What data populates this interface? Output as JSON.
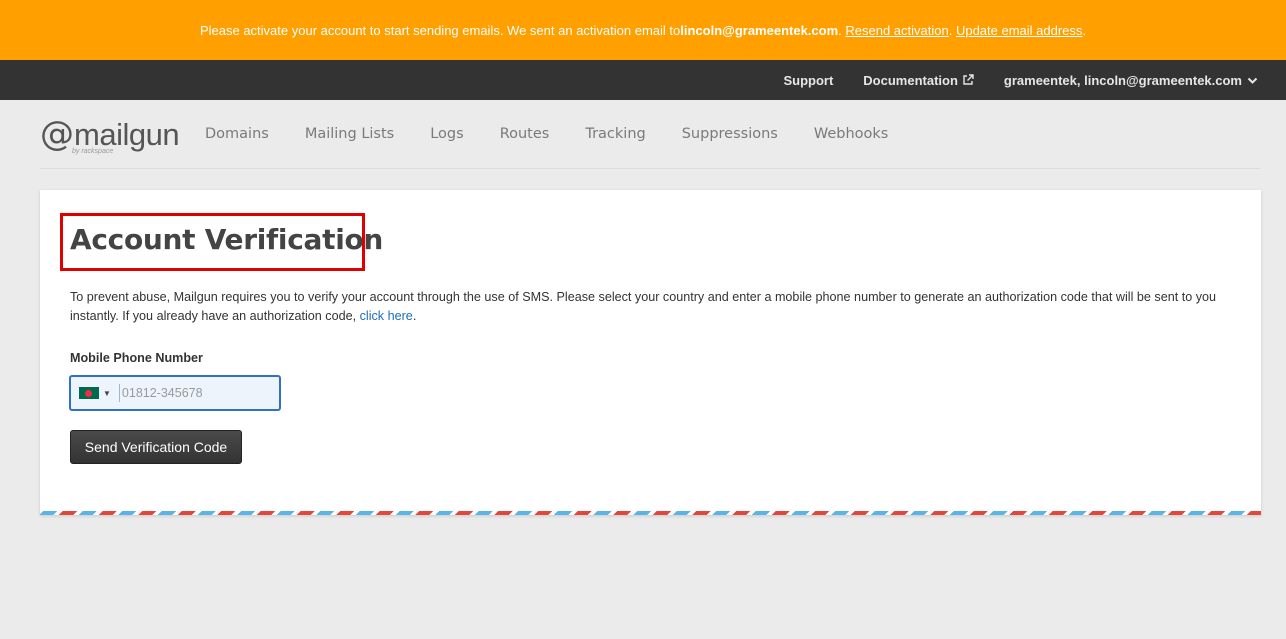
{
  "banner": {
    "text_before": "Please activate your account to start sending emails. We sent an activation email to ",
    "email": "lincoln@grameentek.com",
    "sep1": ". ",
    "resend_link": "Resend activation",
    "sep2": ". ",
    "update_link": "Update email address",
    "end": "."
  },
  "topbar": {
    "support": "Support",
    "documentation": "Documentation",
    "account": "grameentek, lincoln@grameentek.com"
  },
  "logo": {
    "at": "@",
    "word": "mailgun",
    "by": "by rackspace"
  },
  "nav": {
    "links": [
      "Domains",
      "Mailing Lists",
      "Logs",
      "Routes",
      "Tracking",
      "Suppressions",
      "Webhooks"
    ]
  },
  "main": {
    "title": "Account Verification",
    "description_text": "To prevent abuse, Mailgun requires you to verify your account through the use of SMS. Please select your country and enter a mobile phone number to generate an authorization code that will be sent to you instantly. If you already have an authorization code, ",
    "description_link": "click here",
    "description_end": ".",
    "phone_label": "Mobile Phone Number",
    "phone_value": "",
    "phone_placeholder": "01812-345678",
    "send_button": "Send Verification Code"
  },
  "colors": {
    "banner": "#ff9f00",
    "topbar": "#333333",
    "highlight_box": "#e00000",
    "link": "#1a6ebd",
    "flag_green": "#006a4e",
    "flag_red": "#f42a41"
  }
}
